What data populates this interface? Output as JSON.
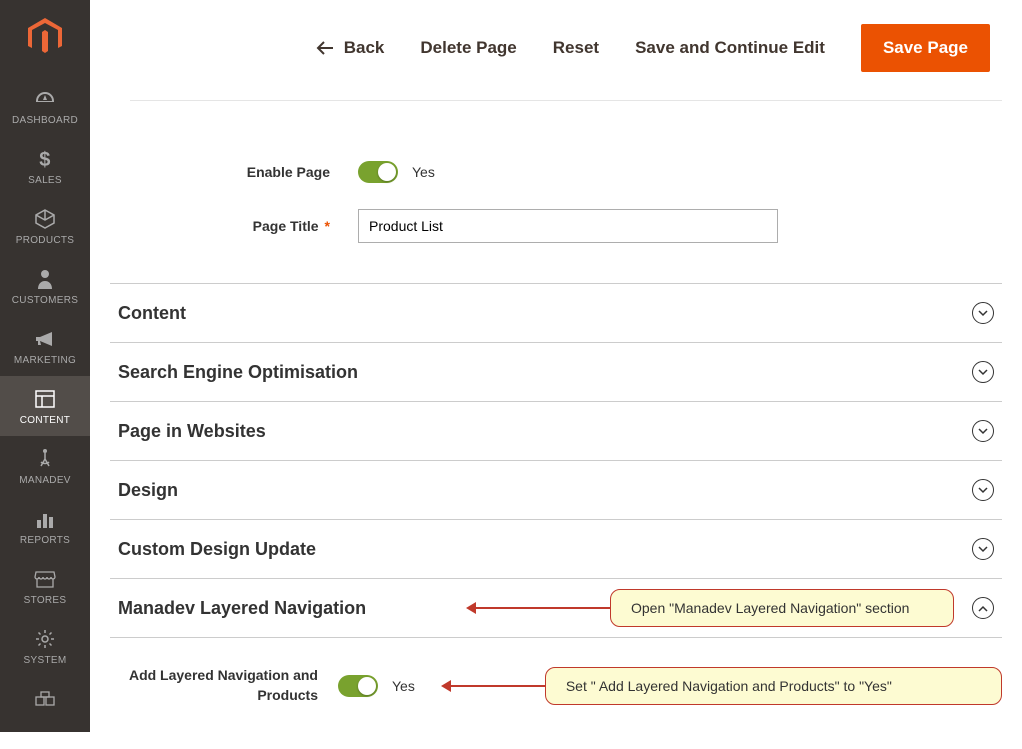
{
  "sidebar": {
    "items": [
      {
        "label": "DASHBOARD"
      },
      {
        "label": "SALES"
      },
      {
        "label": "PRODUCTS"
      },
      {
        "label": "CUSTOMERS"
      },
      {
        "label": "MARKETING"
      },
      {
        "label": "CONTENT"
      },
      {
        "label": "MANADEV"
      },
      {
        "label": "REPORTS"
      },
      {
        "label": "STORES"
      },
      {
        "label": "SYSTEM"
      }
    ]
  },
  "toolbar": {
    "back": "Back",
    "delete": "Delete Page",
    "reset": "Reset",
    "save_continue": "Save and Continue Edit",
    "save": "Save Page"
  },
  "form": {
    "enable_label": "Enable Page",
    "enable_value": "Yes",
    "title_label": "Page Title",
    "title_value": "Product List"
  },
  "accordion": {
    "content": "Content",
    "seo": "Search Engine Optimisation",
    "piw": "Page in Websites",
    "design": "Design",
    "cdu": "Custom Design Update",
    "mln": "Manadev Layered Navigation"
  },
  "manadev": {
    "add_label": "Add Layered Navigation and Products",
    "add_value": "Yes"
  },
  "callouts": {
    "open_section": "Open \"Manadev Layered Navigation\" section",
    "set_yes": "Set \" Add Layered Navigation and Products\" to \"Yes\""
  },
  "colors": {
    "accent": "#eb5202",
    "sidebar_bg": "#373330",
    "toggle_on": "#79a22e",
    "callout_bg": "#fdfbd2",
    "callout_border": "#c0392b"
  }
}
